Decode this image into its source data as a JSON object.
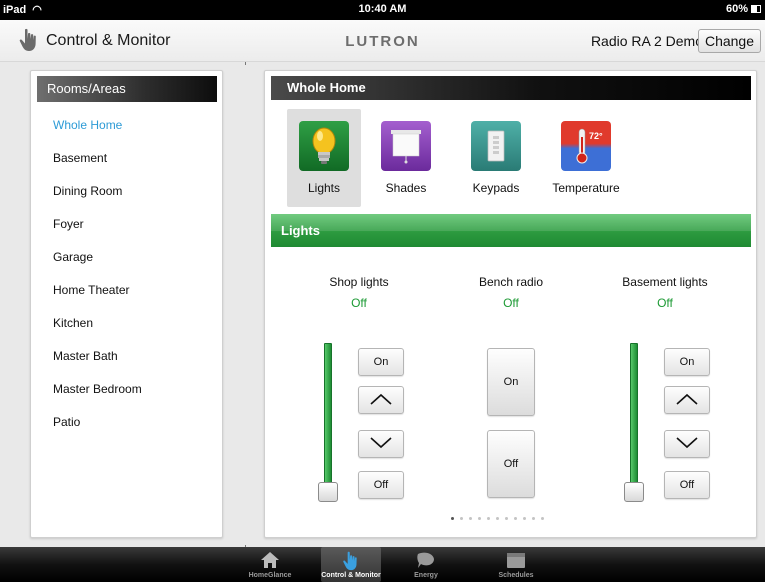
{
  "status_bar": {
    "carrier": "iPad",
    "time": "10:40 AM",
    "battery": "60%"
  },
  "header": {
    "title": "Control & Monitor",
    "brand": "LUTRON",
    "system_name": "Radio RA 2 Demo",
    "change_label": "Change"
  },
  "sidebar": {
    "title": "Rooms/Areas",
    "selected": "Whole Home",
    "items": [
      {
        "label": "Whole Home"
      },
      {
        "label": "Basement"
      },
      {
        "label": "Dining Room"
      },
      {
        "label": "Foyer"
      },
      {
        "label": "Garage"
      },
      {
        "label": "Home Theater"
      },
      {
        "label": "Kitchen"
      },
      {
        "label": "Master Bath"
      },
      {
        "label": "Master Bedroom"
      },
      {
        "label": "Patio"
      }
    ]
  },
  "main": {
    "section_title": "Whole Home",
    "device_types": [
      {
        "label": "Lights",
        "icon": "bulb-icon",
        "selected": true
      },
      {
        "label": "Shades",
        "icon": "shade-icon",
        "selected": false
      },
      {
        "label": "Keypads",
        "icon": "keypad-icon",
        "selected": false
      },
      {
        "label": "Temperature",
        "icon": "thermometer-icon",
        "selected": false,
        "badge": "72°"
      }
    ],
    "category_bar": "Lights",
    "zones": [
      {
        "name": "Shop lights",
        "state": "Off",
        "control": "dimmer",
        "on_label": "On",
        "off_label": "Off",
        "level_percent": 0
      },
      {
        "name": "Bench radio",
        "state": "Off",
        "control": "switch",
        "on_label": "On",
        "off_label": "Off"
      },
      {
        "name": "Basement lights",
        "state": "Off",
        "control": "dimmer",
        "on_label": "On",
        "off_label": "Off",
        "level_percent": 0
      }
    ],
    "page_indicator": {
      "total": 11,
      "current": 1
    }
  },
  "tab_bar": {
    "tabs": [
      {
        "label": "HomeGlance",
        "icon": "house-icon",
        "active": false
      },
      {
        "label": "Control & Monitor",
        "icon": "hand-pointer-icon",
        "active": true
      },
      {
        "label": "Energy",
        "icon": "leaf-icon",
        "active": false
      },
      {
        "label": "Schedules",
        "icon": "calendar-icon",
        "active": false
      }
    ]
  },
  "colors": {
    "accent_blue": "#2d9bd6",
    "status_green": "#1c9a34",
    "lights_bar_green": "#2c9a3f"
  }
}
